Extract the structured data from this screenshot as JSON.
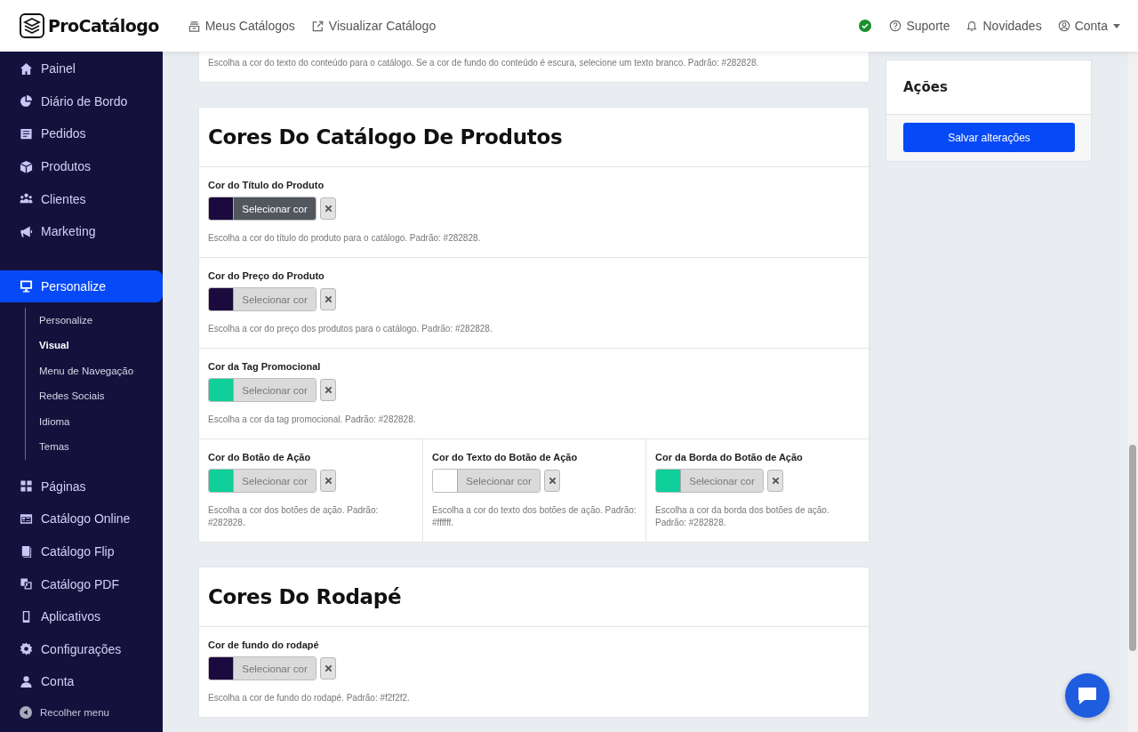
{
  "brand": {
    "name": "ProCatálogo"
  },
  "top_nav": [
    {
      "label": "Meus Catálogos"
    },
    {
      "label": "Visualizar Catálogo"
    }
  ],
  "connection_ok": true,
  "user_nav": [
    {
      "label": "Suporte"
    },
    {
      "label": "Novidades"
    },
    {
      "label": "Conta"
    }
  ],
  "sidebar": {
    "items": [
      {
        "label": "Painel",
        "selected": false
      },
      {
        "label": "Diário de Bordo",
        "selected": false
      },
      {
        "label": "Pedidos",
        "selected": false
      },
      {
        "label": "Produtos",
        "selected": false
      },
      {
        "label": "Clientes",
        "selected": false
      },
      {
        "label": "Marketing",
        "selected": false
      },
      {
        "label": "Personalize",
        "selected": true,
        "children": [
          {
            "label": "Personalize",
            "selected": false
          },
          {
            "label": "Visual",
            "selected": true
          },
          {
            "label": "Menu de Navegação",
            "selected": false
          },
          {
            "label": "Redes Sociais",
            "selected": false
          },
          {
            "label": "Idioma",
            "selected": false
          },
          {
            "label": "Temas",
            "selected": false
          }
        ]
      },
      {
        "label": "Páginas",
        "selected": false
      },
      {
        "label": "Catálogo Online",
        "selected": false
      },
      {
        "label": "Catálogo Flip",
        "selected": false
      },
      {
        "label": "Catálogo PDF",
        "selected": false
      },
      {
        "label": "Aplicativos",
        "selected": false
      },
      {
        "label": "Configurações",
        "selected": false
      },
      {
        "label": "Conta",
        "selected": false
      }
    ],
    "collapse": "Recolher menu"
  },
  "sections": [
    {
      "rows": [
        {
          "fields": [
            {
              "description": "Escolha a cor do texto do conteúdo para o catálogo. Se a cor de fundo do conteúdo é escura, selecione um texto branco. Padrão: #282828."
            }
          ]
        }
      ]
    },
    {
      "title": "Cores Do Catálogo De Produtos",
      "rows": [
        {
          "fields": [
            {
              "label": "Cor do Título do Produto",
              "color": "#1a0a3d",
              "button": "Selecionar cor",
              "active": true,
              "description": "Escolha a cor do título do produto para o catálogo. Padrão: #282828."
            }
          ]
        },
        {
          "fields": [
            {
              "label": "Cor do Preço do Produto",
              "color": "#1a0a3d",
              "button": "Selecionar cor",
              "active": false,
              "description": "Escolha a cor do preço dos produtos para o catálogo. Padrão: #282828."
            }
          ]
        },
        {
          "fields": [
            {
              "label": "Cor da Tag Promocional",
              "color": "#0fcf9a",
              "button": "Selecionar cor",
              "active": false,
              "description": "Escolha a cor da tag promocional. Padrão: #282828."
            }
          ]
        },
        {
          "fields": [
            {
              "label": "Cor do Botão de Ação",
              "color": "#0fcf9a",
              "button": "Selecionar cor",
              "active": false,
              "description": "Escolha a cor dos botões de ação. Padrão: #282828."
            },
            {
              "label": "Cor do Texto do Botão de Ação",
              "color": "#ffffff",
              "button": "Selecionar cor",
              "active": false,
              "description": "Escolha a cor do texto dos botões de ação. Padrão: #ffffff."
            },
            {
              "label": "Cor da Borda do Botão de Ação",
              "color": "#0fcf9a",
              "button": "Selecionar cor",
              "active": false,
              "description": "Escolha a cor da borda dos botões de ação. Padrão: #282828."
            }
          ]
        }
      ]
    },
    {
      "title": "Cores Do Rodapé",
      "rows": [
        {
          "fields": [
            {
              "label": "Cor de fundo do rodapé",
              "color": "#1a0a3d",
              "button": "Selecionar cor",
              "active": false,
              "description": "Escolha a cor de fundo do rodapé. Padrão: #f2f2f2."
            }
          ]
        }
      ]
    }
  ],
  "actions": {
    "title": "Ações",
    "button": "Salvar alterações"
  }
}
